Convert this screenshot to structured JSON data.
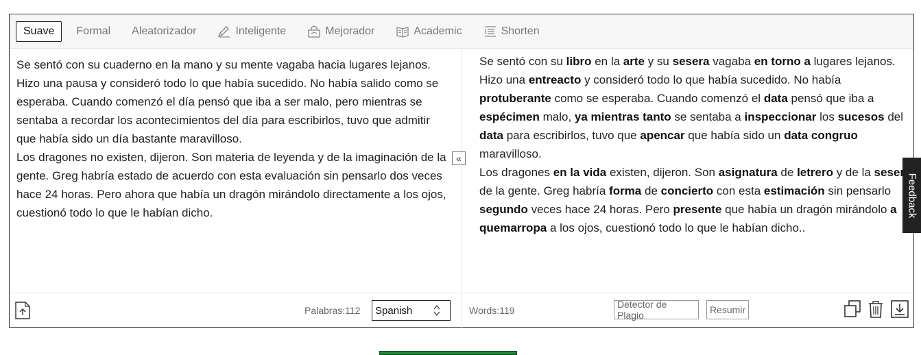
{
  "modes": [
    {
      "label": "Suave",
      "icon": "",
      "active": true
    },
    {
      "label": "Formal",
      "icon": "",
      "active": false
    },
    {
      "label": "Aleatorizador",
      "icon": "",
      "active": false
    },
    {
      "label": "Inteligente",
      "icon": "pen-icon",
      "active": false
    },
    {
      "label": "Mejorador",
      "icon": "enhance-icon",
      "active": false
    },
    {
      "label": "Academic",
      "icon": "book-icon",
      "active": false
    },
    {
      "label": "Shorten",
      "icon": "list-icon",
      "active": false
    }
  ],
  "input": {
    "text": "Se sentó con su cuaderno en la mano y su mente vagaba hacia lugares lejanos. Hizo una pausa y consideró todo lo que había sucedido. No había salido como se esperaba. Cuando comenzó el día pensó que iba a ser malo, pero mientras se sentaba a recordar los acontecimientos del día para escribirlos, tuvo que admitir que había sido un día bastante maravilloso.\nLos dragones no existen, dijeron. Son materia de leyenda y de la imaginación de la gente. Greg habría estado de acuerdo con esta evaluación sin pensarlo dos veces hace 24 horas. Pero ahora que había un dragón mirándolo directamente a los ojos, cuestionó todo lo que le habían dicho.",
    "word_count": "Palabras:112",
    "language": "Spanish"
  },
  "output": {
    "segments": [
      [
        "Se sentó con su ",
        false
      ],
      [
        "libro",
        true
      ],
      [
        " en la ",
        false
      ],
      [
        "arte",
        true
      ],
      [
        " y su ",
        false
      ],
      [
        "sesera",
        true
      ],
      [
        " vagaba ",
        false
      ],
      [
        "en torno a",
        true
      ],
      [
        " lugares lejanos. Hizo una ",
        false
      ],
      [
        "entreacto",
        true
      ],
      [
        " y consideró todo lo que había sucedido. No había ",
        false
      ],
      [
        "protuberante",
        true
      ],
      [
        " como se esperaba. Cuando comenzó el ",
        false
      ],
      [
        "data",
        true
      ],
      [
        " pensó que iba a ",
        false
      ],
      [
        "espécimen",
        true
      ],
      [
        " malo, ",
        false
      ],
      [
        "ya mientras tanto",
        true
      ],
      [
        " se sentaba a ",
        false
      ],
      [
        "inspeccionar",
        true
      ],
      [
        " los ",
        false
      ],
      [
        "sucesos",
        true
      ],
      [
        " del ",
        false
      ],
      [
        "data",
        true
      ],
      [
        " para escribirlos, tuvo que ",
        false
      ],
      [
        "apencar",
        true
      ],
      [
        " que había sido un ",
        false
      ],
      [
        "data congruo",
        true
      ],
      [
        " maravilloso.",
        false
      ],
      [
        "\n",
        false
      ],
      [
        "Los dragones ",
        false
      ],
      [
        "en la vida",
        true
      ],
      [
        " existen, dijeron. Son ",
        false
      ],
      [
        "asignatura",
        true
      ],
      [
        " de ",
        false
      ],
      [
        "letrero",
        true
      ],
      [
        " y de la ",
        false
      ],
      [
        "sesera",
        true
      ],
      [
        " de la gente. Greg habría ",
        false
      ],
      [
        "forma",
        true
      ],
      [
        " de ",
        false
      ],
      [
        "concierto",
        true
      ],
      [
        " con esta ",
        false
      ],
      [
        "estimación",
        true
      ],
      [
        " sin pensarlo ",
        false
      ],
      [
        "segundo",
        true
      ],
      [
        " veces hace 24 horas. Pero ",
        false
      ],
      [
        "presente",
        true
      ],
      [
        " que había un dragón mirándolo ",
        false
      ],
      [
        "a quemarropa",
        true
      ],
      [
        " a los ojos, cuestionó todo lo que le habían dicho..",
        false
      ]
    ],
    "word_count": "Words:119",
    "plagiarism_label": "Detector de Plagio",
    "summarize_label": "Resumir"
  },
  "collapse_glyph": "«",
  "feedback_label": "Feedback"
}
